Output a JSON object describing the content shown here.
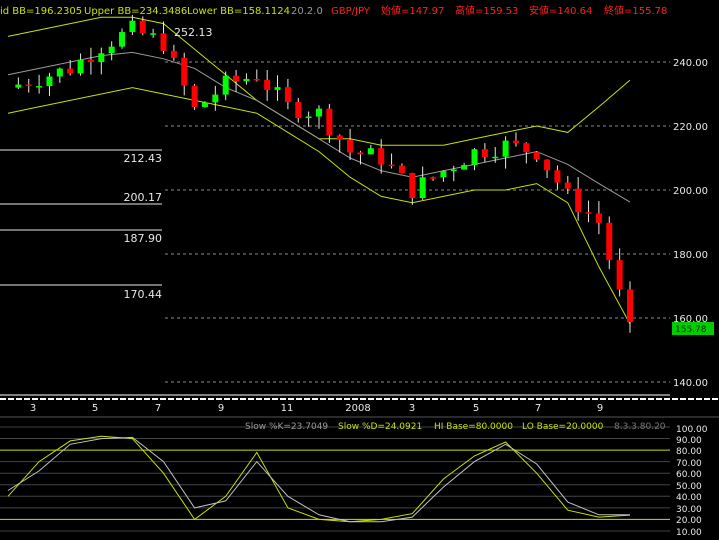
{
  "header": {
    "mid_bb": "id BB=196.2305",
    "upper_bb": "Upper BB=234.3486",
    "lower_bb": "Lower BB=158.1124",
    "params": "20.2.0",
    "symbol": "GBP/JPY",
    "open_label": "始値=147.97",
    "high_label": "高値=159.53",
    "low_label": "安値=140.64",
    "close_label": "終値=155.78"
  },
  "price_tag": "155.78",
  "peak_label": "252.13",
  "fib_levels": [
    "212.43",
    "200.17",
    "187.90",
    "170.44"
  ],
  "price_axis": [
    "240.00",
    "220.00",
    "200.00",
    "180.00",
    "160.00",
    "140.00"
  ],
  "month_axis": [
    "3",
    "5",
    "7",
    "9",
    "11",
    "2008",
    "3",
    "5",
    "7",
    "9"
  ],
  "osc_header": {
    "k_label": "Slow %K=23.7049",
    "d_label": "Slow %D=24.0921",
    "hi_base": "HI Base=80.0000",
    "lo_base": "LO Base=20.0000",
    "params": "8.3.3.80.20"
  },
  "osc_axis": [
    "100.00",
    "90.00",
    "80.00",
    "70.00",
    "60.00",
    "50.00",
    "40.00",
    "30.00",
    "20.00",
    "10.00"
  ],
  "colors": {
    "up_candle": "#00ff00",
    "down_candle": "#ff0000",
    "bollinger": "#c8e000",
    "mid_band": "#9a9a9a",
    "stoch_k": "#ffff00",
    "stoch_d": "#c0c0c0",
    "header_text": "#ff2020",
    "price_tag_bg": "#00cc00"
  },
  "chart_data": {
    "type": "candlestick",
    "symbol": "GBP/JPY",
    "ylim": [
      137,
      258
    ],
    "x": [
      "2007-02",
      "2007-03",
      "2007-04",
      "2007-05",
      "2007-06",
      "2007-07",
      "2007-08",
      "2007-09",
      "2007-10",
      "2007-11",
      "2007-12",
      "2008-01",
      "2008-02",
      "2008-03",
      "2008-04",
      "2008-05",
      "2008-06",
      "2008-07",
      "2008-08",
      "2008-09",
      "2008-10"
    ],
    "close": [
      232,
      235,
      238,
      245,
      250,
      246,
      225,
      233,
      236,
      226,
      224,
      212,
      210,
      200,
      206,
      212,
      214,
      212,
      198,
      190,
      155.78
    ],
    "upper_band": [
      248,
      250,
      252,
      254,
      254,
      252,
      244,
      236,
      228,
      222,
      216,
      216,
      214,
      214,
      214,
      216,
      218,
      220,
      218,
      226,
      234.35
    ],
    "mid_band": [
      236,
      238,
      240,
      242,
      243,
      241,
      238,
      232,
      228,
      222,
      216,
      210,
      206,
      204,
      206,
      208,
      210,
      212,
      208,
      202,
      196.23
    ],
    "lower_band": [
      224,
      226,
      228,
      230,
      232,
      230,
      228,
      226,
      224,
      218,
      212,
      204,
      198,
      196,
      198,
      200,
      200,
      202,
      196,
      176,
      158.11
    ],
    "stochastic": {
      "slow_k": [
        40,
        70,
        88,
        92,
        90,
        60,
        20,
        40,
        78,
        30,
        20,
        18,
        20,
        25,
        55,
        75,
        87,
        60,
        28,
        22,
        23.7
      ],
      "slow_d": [
        45,
        62,
        85,
        90,
        91,
        70,
        30,
        36,
        70,
        40,
        24,
        18,
        18,
        22,
        48,
        70,
        85,
        68,
        35,
        24,
        24.09
      ],
      "hi_base": 80,
      "lo_base": 20,
      "ylim": [
        10,
        100
      ]
    }
  }
}
